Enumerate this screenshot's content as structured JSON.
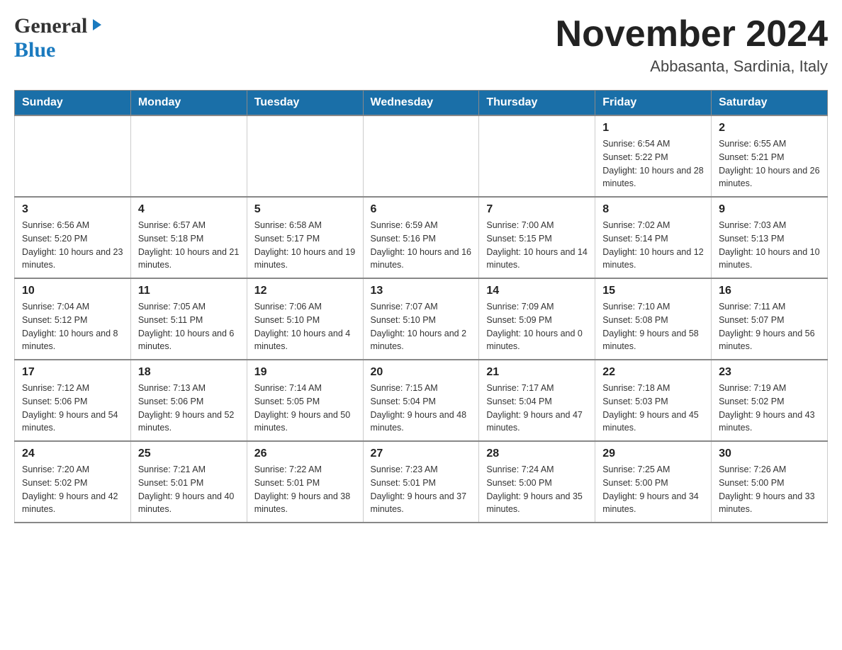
{
  "header": {
    "logo": {
      "general": "General",
      "blue": "Blue",
      "arrow": "▶"
    },
    "title": "November 2024",
    "location": "Abbasanta, Sardinia, Italy"
  },
  "calendar": {
    "days_of_week": [
      "Sunday",
      "Monday",
      "Tuesday",
      "Wednesday",
      "Thursday",
      "Friday",
      "Saturday"
    ],
    "weeks": [
      [
        {
          "day": "",
          "info": ""
        },
        {
          "day": "",
          "info": ""
        },
        {
          "day": "",
          "info": ""
        },
        {
          "day": "",
          "info": ""
        },
        {
          "day": "",
          "info": ""
        },
        {
          "day": "1",
          "info": "Sunrise: 6:54 AM\nSunset: 5:22 PM\nDaylight: 10 hours and 28 minutes."
        },
        {
          "day": "2",
          "info": "Sunrise: 6:55 AM\nSunset: 5:21 PM\nDaylight: 10 hours and 26 minutes."
        }
      ],
      [
        {
          "day": "3",
          "info": "Sunrise: 6:56 AM\nSunset: 5:20 PM\nDaylight: 10 hours and 23 minutes."
        },
        {
          "day": "4",
          "info": "Sunrise: 6:57 AM\nSunset: 5:18 PM\nDaylight: 10 hours and 21 minutes."
        },
        {
          "day": "5",
          "info": "Sunrise: 6:58 AM\nSunset: 5:17 PM\nDaylight: 10 hours and 19 minutes."
        },
        {
          "day": "6",
          "info": "Sunrise: 6:59 AM\nSunset: 5:16 PM\nDaylight: 10 hours and 16 minutes."
        },
        {
          "day": "7",
          "info": "Sunrise: 7:00 AM\nSunset: 5:15 PM\nDaylight: 10 hours and 14 minutes."
        },
        {
          "day": "8",
          "info": "Sunrise: 7:02 AM\nSunset: 5:14 PM\nDaylight: 10 hours and 12 minutes."
        },
        {
          "day": "9",
          "info": "Sunrise: 7:03 AM\nSunset: 5:13 PM\nDaylight: 10 hours and 10 minutes."
        }
      ],
      [
        {
          "day": "10",
          "info": "Sunrise: 7:04 AM\nSunset: 5:12 PM\nDaylight: 10 hours and 8 minutes."
        },
        {
          "day": "11",
          "info": "Sunrise: 7:05 AM\nSunset: 5:11 PM\nDaylight: 10 hours and 6 minutes."
        },
        {
          "day": "12",
          "info": "Sunrise: 7:06 AM\nSunset: 5:10 PM\nDaylight: 10 hours and 4 minutes."
        },
        {
          "day": "13",
          "info": "Sunrise: 7:07 AM\nSunset: 5:10 PM\nDaylight: 10 hours and 2 minutes."
        },
        {
          "day": "14",
          "info": "Sunrise: 7:09 AM\nSunset: 5:09 PM\nDaylight: 10 hours and 0 minutes."
        },
        {
          "day": "15",
          "info": "Sunrise: 7:10 AM\nSunset: 5:08 PM\nDaylight: 9 hours and 58 minutes."
        },
        {
          "day": "16",
          "info": "Sunrise: 7:11 AM\nSunset: 5:07 PM\nDaylight: 9 hours and 56 minutes."
        }
      ],
      [
        {
          "day": "17",
          "info": "Sunrise: 7:12 AM\nSunset: 5:06 PM\nDaylight: 9 hours and 54 minutes."
        },
        {
          "day": "18",
          "info": "Sunrise: 7:13 AM\nSunset: 5:06 PM\nDaylight: 9 hours and 52 minutes."
        },
        {
          "day": "19",
          "info": "Sunrise: 7:14 AM\nSunset: 5:05 PM\nDaylight: 9 hours and 50 minutes."
        },
        {
          "day": "20",
          "info": "Sunrise: 7:15 AM\nSunset: 5:04 PM\nDaylight: 9 hours and 48 minutes."
        },
        {
          "day": "21",
          "info": "Sunrise: 7:17 AM\nSunset: 5:04 PM\nDaylight: 9 hours and 47 minutes."
        },
        {
          "day": "22",
          "info": "Sunrise: 7:18 AM\nSunset: 5:03 PM\nDaylight: 9 hours and 45 minutes."
        },
        {
          "day": "23",
          "info": "Sunrise: 7:19 AM\nSunset: 5:02 PM\nDaylight: 9 hours and 43 minutes."
        }
      ],
      [
        {
          "day": "24",
          "info": "Sunrise: 7:20 AM\nSunset: 5:02 PM\nDaylight: 9 hours and 42 minutes."
        },
        {
          "day": "25",
          "info": "Sunrise: 7:21 AM\nSunset: 5:01 PM\nDaylight: 9 hours and 40 minutes."
        },
        {
          "day": "26",
          "info": "Sunrise: 7:22 AM\nSunset: 5:01 PM\nDaylight: 9 hours and 38 minutes."
        },
        {
          "day": "27",
          "info": "Sunrise: 7:23 AM\nSunset: 5:01 PM\nDaylight: 9 hours and 37 minutes."
        },
        {
          "day": "28",
          "info": "Sunrise: 7:24 AM\nSunset: 5:00 PM\nDaylight: 9 hours and 35 minutes."
        },
        {
          "day": "29",
          "info": "Sunrise: 7:25 AM\nSunset: 5:00 PM\nDaylight: 9 hours and 34 minutes."
        },
        {
          "day": "30",
          "info": "Sunrise: 7:26 AM\nSunset: 5:00 PM\nDaylight: 9 hours and 33 minutes."
        }
      ]
    ]
  }
}
